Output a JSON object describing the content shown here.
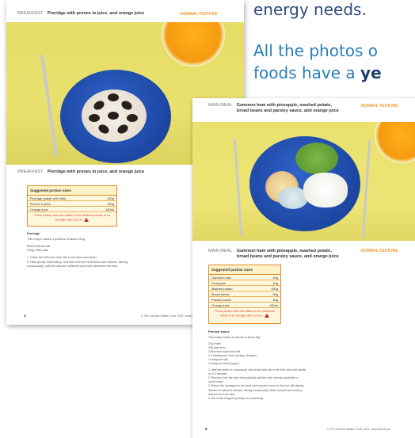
{
  "background": {
    "line1": "energy needs.",
    "line2": "All the photos o",
    "line3_prefix": "foods have a ",
    "line3_bold": "ye"
  },
  "page1": {
    "category": "BREAKFAST",
    "title": "Porridge with prunes in juice, and orange juice",
    "texture": "NORMAL TEXTURE",
    "subheader_category": "BREAKFAST",
    "subheader_title": "Porridge with prunes in juice, and orange juice",
    "portion": {
      "heading": "Suggested portion sizes",
      "rows": [
        {
          "item": "Porridge (made with milk)",
          "qty": "220g"
        },
        {
          "item": "Prunes in juice",
          "qty": "100g"
        },
        {
          "item": "Orange juice",
          "qty": "150ml"
        }
      ],
      "note": "These portion sizes are based on the nutritional needs of an average older person."
    },
    "recipe": {
      "heading": "Porridge",
      "lines": [
        "This recipe makes 4 portions of about 220g.",
        "",
        "800ml full fat milk",
        "120g rolled oats",
        "",
        "1. Place the milk and oats into a non-stick saucepan.",
        "2. Heat gently until boiling, and then turn the heat down and simmer, stirring",
        "   occasionally, until the oats are softened and have absorbed the milk."
      ]
    },
    "page_number": "4",
    "copyright": "© The Caroline Walker Trust, 2021. www.cwt.org.uk"
  },
  "page2": {
    "category": "MAIN MEAL",
    "title_line1": "Gammon ham with pineapple, mashed potato,",
    "title_line2": "broad beans and parsley sauce, and orange juice",
    "texture": "NORMAL TEXTURE",
    "subheader_category": "MAIN MEAL",
    "subheader_title_line1": "Gammon ham with pineapple, mashed potato,",
    "subheader_title_line2": "broad beans and parsley sauce, and orange juice",
    "portion": {
      "heading": "Suggested portion sizes",
      "rows": [
        {
          "item": "Gammon ham",
          "qty": "50g"
        },
        {
          "item": "Pineapple",
          "qty": "40g"
        },
        {
          "item": "Mashed potato",
          "qty": "150g"
        },
        {
          "item": "Broad beans",
          "qty": "80g"
        },
        {
          "item": "Parsley sauce",
          "qty": "40g"
        },
        {
          "item": "Orange juice",
          "qty": "150ml"
        }
      ],
      "note": "These portion sizes are based on the nutritional needs of an average older person."
    },
    "recipe": {
      "heading": "Parsley sauce",
      "lines": [
        "This recipe makes 4 portions of about 40g.",
        "",
        "20g butter",
        "20g plain flour",
        "200ml semi-skimmed milk",
        "1-2 tablespoons fresh parsley, chopped",
        "¼ teaspoon salt",
        "⅛ teaspoon black pepper",
        "",
        "1. Melt the butter in a saucepan over a low heat, stir in the flour and cook gently",
        "   for 2-3 minutes.",
        "2. Remove from the heat and gradually add the milk, stirring constantly to",
        "   avoid lumps.",
        "3. Return the saucepan to the heat and bring the sauce to the boil, still stirring.",
        "   Simmer for about 8 minutes, stirring occasionally. When smooth and creamy,",
        "   remove from the heat.",
        "4. Stir in the chopped parsley and seasoning."
      ]
    },
    "page_number": "9",
    "copyright": "© The Caroline Walker Trust, 2021. www.cwt.org.uk"
  }
}
